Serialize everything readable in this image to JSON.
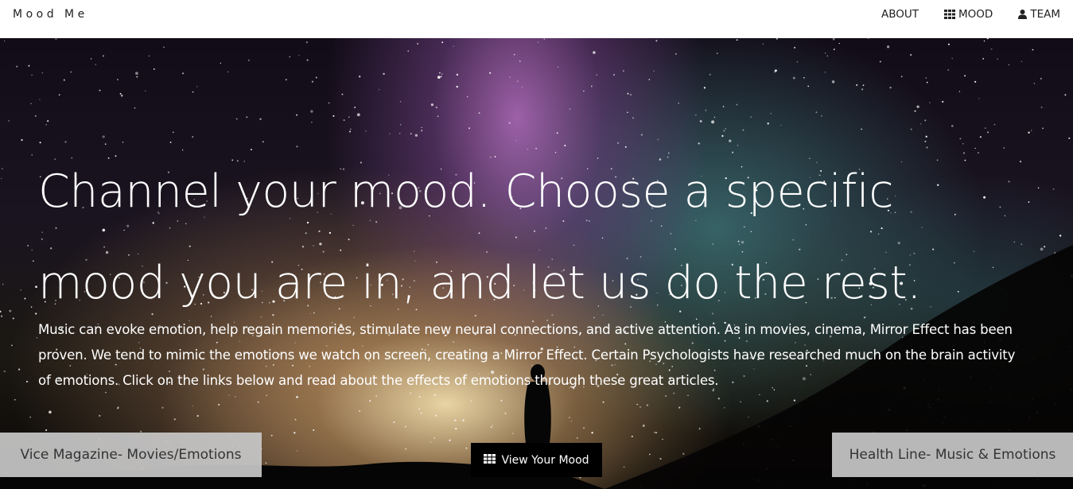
{
  "header": {
    "brand": "Mood Me",
    "nav": [
      {
        "label": "ABOUT",
        "icon": ""
      },
      {
        "label": "MOOD",
        "icon": "grid-icon"
      },
      {
        "label": "TEAM",
        "icon": "user-icon"
      }
    ]
  },
  "hero": {
    "headline_line1": "Channel your mood. Choose a specific",
    "headline_line2": "mood you are in, and let us do the rest.",
    "paragraph_line1": "Music can evoke emotion, help regain memories, stimulate new neural connections, and active attention. As in movies, cinema, Mirror Effect has been",
    "paragraph_line2": "proven. We tend to mimic the emotions we watch on screen, creating a Mirror Effect. Certain Psychologists have researched much on the brain activity",
    "paragraph_line3": "of emotions. Click on the links below and read about the effects of emotions through these great articles."
  },
  "actions": {
    "left_link": "Vice Magazine- Movies/Emotions",
    "view_mood": "View Your Mood",
    "right_link": "Health Line- Music & Emotions"
  },
  "colors": {
    "topbar": "#ffffff",
    "text_dark": "#222222",
    "button_dark": "#000000",
    "link_button": "#c8c8c8"
  }
}
